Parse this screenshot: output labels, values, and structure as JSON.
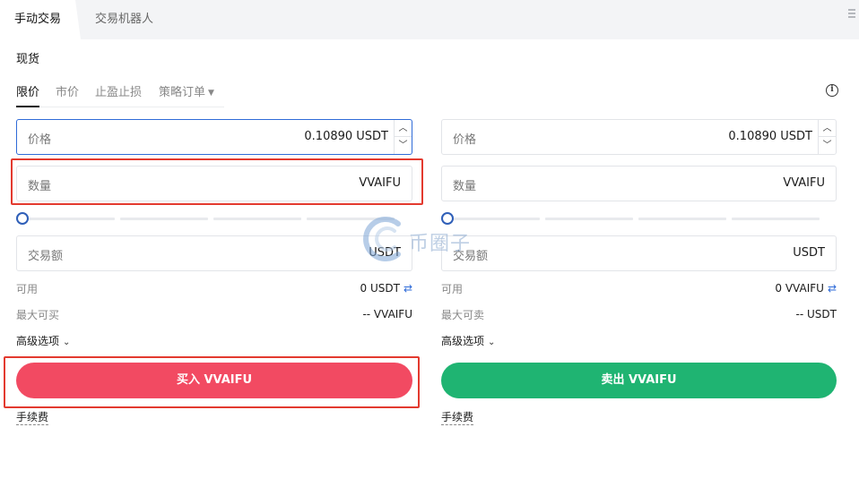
{
  "tabs": [
    {
      "label": "手动交易"
    },
    {
      "label": "交易机器人"
    }
  ],
  "section_title": "现货",
  "order_tabs": [
    {
      "label": "限价"
    },
    {
      "label": "市价"
    },
    {
      "label": "止盈止损"
    },
    {
      "label": "策略订单"
    }
  ],
  "buy": {
    "price": {
      "label": "价格",
      "value": "0.10890 USDT"
    },
    "amount": {
      "label": "数量",
      "value": "VVAIFU"
    },
    "total": {
      "label": "交易额",
      "value": "USDT"
    },
    "available_label": "可用",
    "available_value": "0 USDT",
    "max_label": "最大可买",
    "max_value": "-- VVAIFU",
    "advanced_label": "高级选项",
    "button_label": "买入 VVAIFU",
    "fee_label": "手续费"
  },
  "sell": {
    "price": {
      "label": "价格",
      "value": "0.10890 USDT"
    },
    "amount": {
      "label": "数量",
      "value": "VVAIFU"
    },
    "total": {
      "label": "交易额",
      "value": "USDT"
    },
    "available_label": "可用",
    "available_value": "0 VVAIFU",
    "max_label": "最大可卖",
    "max_value": "-- USDT",
    "advanced_label": "高级选项",
    "button_label": "卖出 VVAIFU",
    "fee_label": "手续费"
  },
  "watermark_text": "币圈子",
  "colors": {
    "buy": "#f24a62",
    "sell": "#1fb472",
    "accent": "#2f6bd8",
    "highlight": "#e33a2f"
  },
  "icons": [
    "menu-icon",
    "info-icon",
    "caret-down-icon",
    "stepper-up-icon",
    "stepper-down-icon",
    "swap-icon",
    "chevron-down-icon"
  ]
}
